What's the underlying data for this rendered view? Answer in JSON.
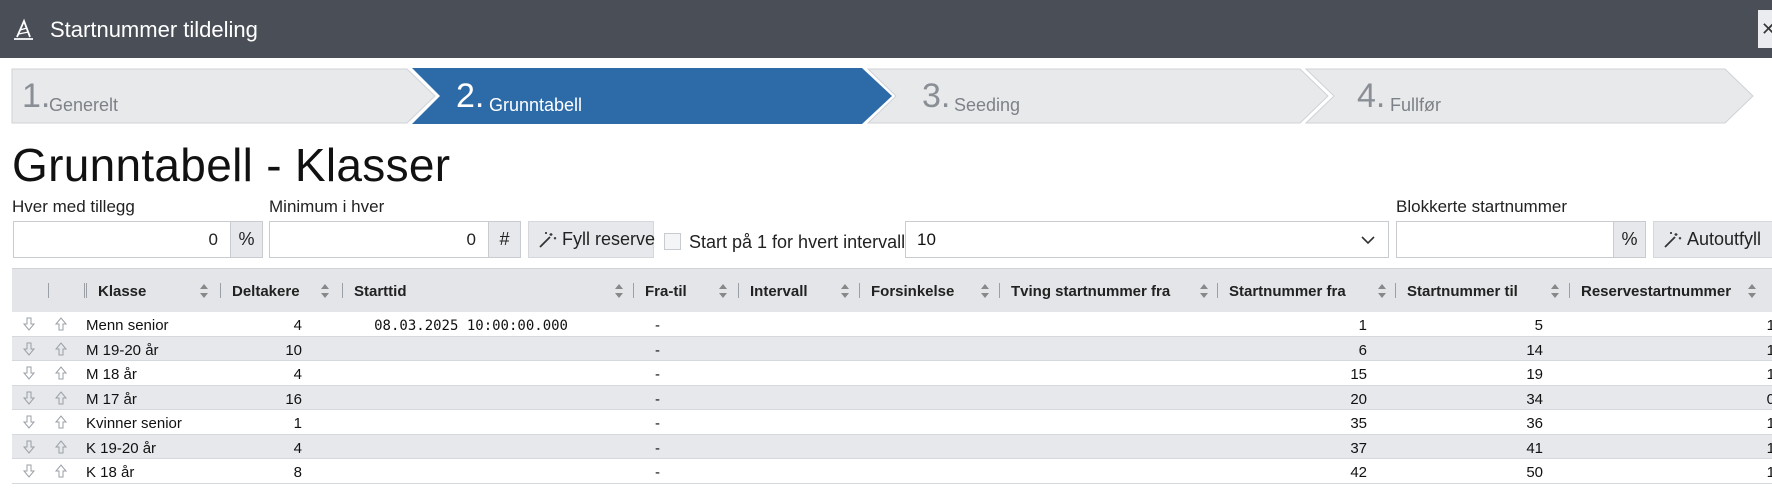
{
  "window": {
    "title": "Startnummer tildeling"
  },
  "wizard": {
    "steps": [
      {
        "number": "1.",
        "label": "Generelt",
        "active": false
      },
      {
        "number": "2.",
        "label": "Grunntabell",
        "active": true
      },
      {
        "number": "3.",
        "label": "Seeding",
        "active": false
      },
      {
        "number": "4.",
        "label": "Fullfør",
        "active": false
      }
    ]
  },
  "page": {
    "title": "Grunntabell - Klasser"
  },
  "toolbar": {
    "hver_med_tillegg": {
      "label": "Hver med tillegg",
      "value": "0",
      "unit": "%"
    },
    "minimum_i_hver": {
      "label": "Minimum i hver",
      "value": "0",
      "unit": "#"
    },
    "fyll_reserve": "Fyll reserve",
    "start_paa_1": {
      "label": "Start på 1 for hvert intervall",
      "checked": false
    },
    "interval_select": {
      "value": "10"
    },
    "blokkerte": {
      "label": "Blokkerte startnummer",
      "value": "",
      "unit": "%"
    },
    "autoutfyll": "Autoutfyll"
  },
  "table": {
    "columns": [
      "Klasse",
      "Deltakere",
      "Starttid",
      "Fra-til",
      "Intervall",
      "Forsinkelse",
      "Tving startnummer fra",
      "Startnummer fra",
      "Startnummer til",
      "Reservestartnummer"
    ],
    "rows": [
      {
        "klasse": "Menn senior",
        "deltakere": "4",
        "starttid": "08.03.2025 10:00:00.000",
        "fratil": "-",
        "fra": "1",
        "til": "5",
        "reserve": "1"
      },
      {
        "klasse": "M 19-20 år",
        "deltakere": "10",
        "starttid": "",
        "fratil": "-",
        "fra": "6",
        "til": "14",
        "reserve": "1"
      },
      {
        "klasse": "M 18 år",
        "deltakere": "4",
        "starttid": "",
        "fratil": "-",
        "fra": "15",
        "til": "19",
        "reserve": "1"
      },
      {
        "klasse": "M 17 år",
        "deltakere": "16",
        "starttid": "",
        "fratil": "-",
        "fra": "20",
        "til": "34",
        "reserve": "0"
      },
      {
        "klasse": "Kvinner senior",
        "deltakere": "1",
        "starttid": "",
        "fratil": "-",
        "fra": "35",
        "til": "36",
        "reserve": "1"
      },
      {
        "klasse": "K 19-20 år",
        "deltakere": "4",
        "starttid": "",
        "fratil": "-",
        "fra": "37",
        "til": "41",
        "reserve": "1"
      },
      {
        "klasse": "K 18 år",
        "deltakere": "8",
        "starttid": "",
        "fratil": "-",
        "fra": "42",
        "til": "50",
        "reserve": "1"
      }
    ]
  },
  "colors": {
    "titlebar": "#4a4f57",
    "active_step": "#2d6aa8",
    "inactive_step": "#e8e9eb",
    "row_alt": "#e6e8eb"
  }
}
